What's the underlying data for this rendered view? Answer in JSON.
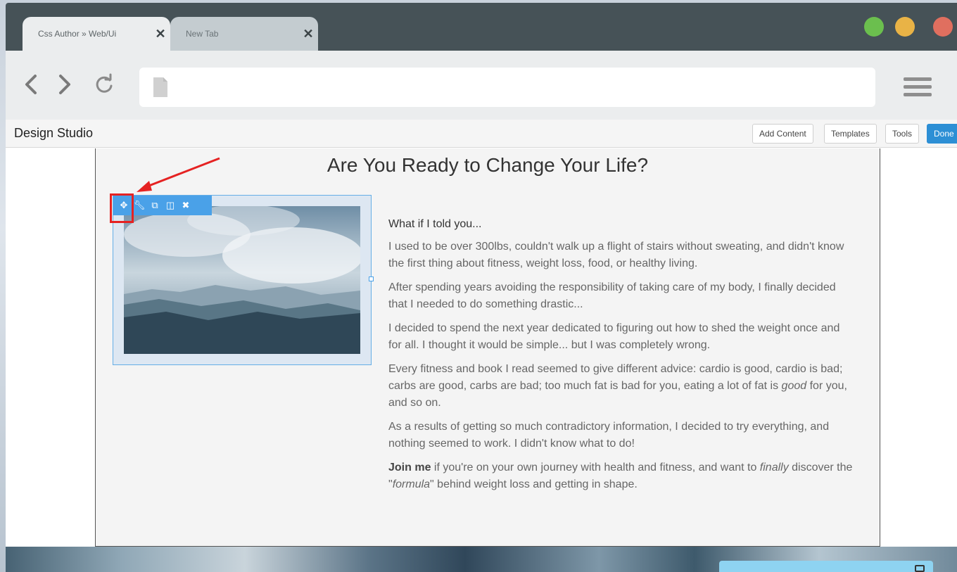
{
  "browser": {
    "tabs": [
      {
        "title": "Css Author » Web/Ui",
        "close": "✕"
      },
      {
        "title": "New Tab",
        "close": "✕"
      }
    ],
    "window_controls": [
      "green",
      "yellow",
      "red"
    ],
    "address": ""
  },
  "studio": {
    "title": "Design Studio",
    "buttons": {
      "add_content": "Add Content",
      "templates": "Templates",
      "tools": "Tools",
      "done": "Done"
    }
  },
  "page": {
    "headline": "Are You Ready to Change Your Life?",
    "image_toolbar_icons": [
      "move-icon",
      "wrench-icon",
      "duplicate-icon",
      "columns-icon",
      "delete-icon"
    ],
    "lead": "What if I told you...",
    "paragraphs": [
      "I used to be over 300lbs, couldn't walk up a flight of stairs without sweating, and didn't know the first thing about fitness, weight loss, food, or healthy living.",
      "After spending years avoiding the responsibility of taking care of my body, I finally decided that I needed to do something drastic...",
      "I decided to spend the next year dedicated to figuring out how to shed the weight once and for all. I thought it would be simple... but I was completely wrong."
    ],
    "p4": {
      "before": "Every fitness and book I read seemed to give different advice: cardio is good, cardio is bad; carbs are good, carbs are bad; too much fat is bad for you, eating a lot of fat is ",
      "em": "good",
      "after": " for you, and so on."
    },
    "p5": "As a results  of getting so much contradictory information, I decided to try everything, and nothing seemed to work. I didn't know what to do!",
    "p6": {
      "bold": "Join me",
      "part1": " if you're on your own journey with health and fitness, and want to ",
      "em1": "finally",
      "part2": " discover the \"",
      "em2": "formula",
      "part3": "\" behind weight loss and getting in shape."
    }
  },
  "colors": {
    "accent": "#2d8fd5",
    "highlight": "#e52222",
    "tab_bar": "#465257"
  }
}
